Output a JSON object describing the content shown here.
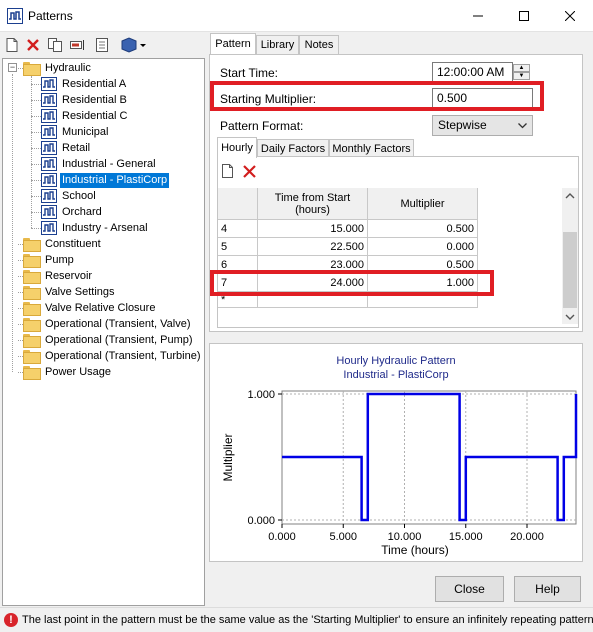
{
  "window": {
    "title": "Patterns"
  },
  "tree": {
    "items": [
      {
        "label": "Hydraulic",
        "type": "folder",
        "level": 0,
        "expanded": true
      },
      {
        "label": "Residential A",
        "type": "pattern",
        "level": 1
      },
      {
        "label": "Residential B",
        "type": "pattern",
        "level": 1
      },
      {
        "label": "Residential C",
        "type": "pattern",
        "level": 1
      },
      {
        "label": "Municipal",
        "type": "pattern",
        "level": 1
      },
      {
        "label": "Retail",
        "type": "pattern",
        "level": 1
      },
      {
        "label": "Industrial - General",
        "type": "pattern",
        "level": 1
      },
      {
        "label": "Industrial - PlastiCorp",
        "type": "pattern",
        "level": 1,
        "selected": true
      },
      {
        "label": "School",
        "type": "pattern",
        "level": 1
      },
      {
        "label": "Orchard",
        "type": "pattern",
        "level": 1
      },
      {
        "label": "Industry - Arsenal",
        "type": "pattern",
        "level": 1
      },
      {
        "label": "Constituent",
        "type": "folder",
        "level": 0
      },
      {
        "label": "Pump",
        "type": "folder",
        "level": 0
      },
      {
        "label": "Reservoir",
        "type": "folder",
        "level": 0
      },
      {
        "label": "Valve Settings",
        "type": "folder",
        "level": 0
      },
      {
        "label": "Valve Relative Closure",
        "type": "folder",
        "level": 0
      },
      {
        "label": "Operational (Transient, Valve)",
        "type": "folder",
        "level": 0
      },
      {
        "label": "Operational (Transient, Pump)",
        "type": "folder",
        "level": 0
      },
      {
        "label": "Operational (Transient, Turbine)",
        "type": "folder",
        "level": 0
      },
      {
        "label": "Power Usage",
        "type": "folder",
        "level": 0
      }
    ]
  },
  "tabs": [
    "Pattern",
    "Library",
    "Notes"
  ],
  "form": {
    "start_time_label": "Start Time:",
    "start_time_value": "12:00:00 AM",
    "starting_multiplier_label": "Starting Multiplier:",
    "starting_multiplier_value": "0.500",
    "pattern_format_label": "Pattern Format:",
    "pattern_format_value": "Stepwise"
  },
  "inner_tabs": [
    "Hourly",
    "Daily Factors",
    "Monthly Factors"
  ],
  "grid": {
    "col_time": "Time from Start (hours)",
    "col_time_line1": "Time from Start",
    "col_time_line2": "(hours)",
    "col_mult": "Multiplier",
    "rows": [
      {
        "index": "4",
        "time": "15.000",
        "mult": "0.500"
      },
      {
        "index": "5",
        "time": "22.500",
        "mult": "0.000"
      },
      {
        "index": "6",
        "time": "23.000",
        "mult": "0.500"
      },
      {
        "index": "7",
        "time": "24.000",
        "mult": "1.000"
      }
    ],
    "new_row_marker": "*"
  },
  "chart_data": {
    "type": "line",
    "title": "Hourly Hydraulic Pattern",
    "subtitle": "Industrial - PlastiCorp",
    "xlabel": "Time (hours)",
    "ylabel": "Multiplier",
    "xlim": [
      0,
      24
    ],
    "ylim": [
      0,
      1
    ],
    "xticks": [
      "0.000",
      "5.000",
      "10.000",
      "15.000",
      "20.000"
    ],
    "yticks": [
      "0.000",
      "1.000"
    ],
    "grid": true,
    "step": true,
    "series": [
      {
        "color": "#0000e6",
        "x": [
          0,
          6.5,
          6.5,
          7,
          7,
          14.5,
          14.5,
          15,
          15,
          22.5,
          22.5,
          23,
          23,
          24,
          24
        ],
        "y": [
          0.5,
          0.5,
          0,
          0,
          1,
          1,
          0,
          0,
          0.5,
          0.5,
          0,
          0,
          0.5,
          0.5,
          1
        ]
      }
    ]
  },
  "buttons": {
    "close": "Close",
    "help": "Help"
  },
  "status": {
    "message": "The last point in the pattern must be the same value as the 'Starting Multiplier' to ensure an infinitely repeating pattern."
  },
  "colors": {
    "highlight": "#e01e24",
    "selection": "#0078d7",
    "series": "#0000e6",
    "title": "#1f2a8a"
  }
}
